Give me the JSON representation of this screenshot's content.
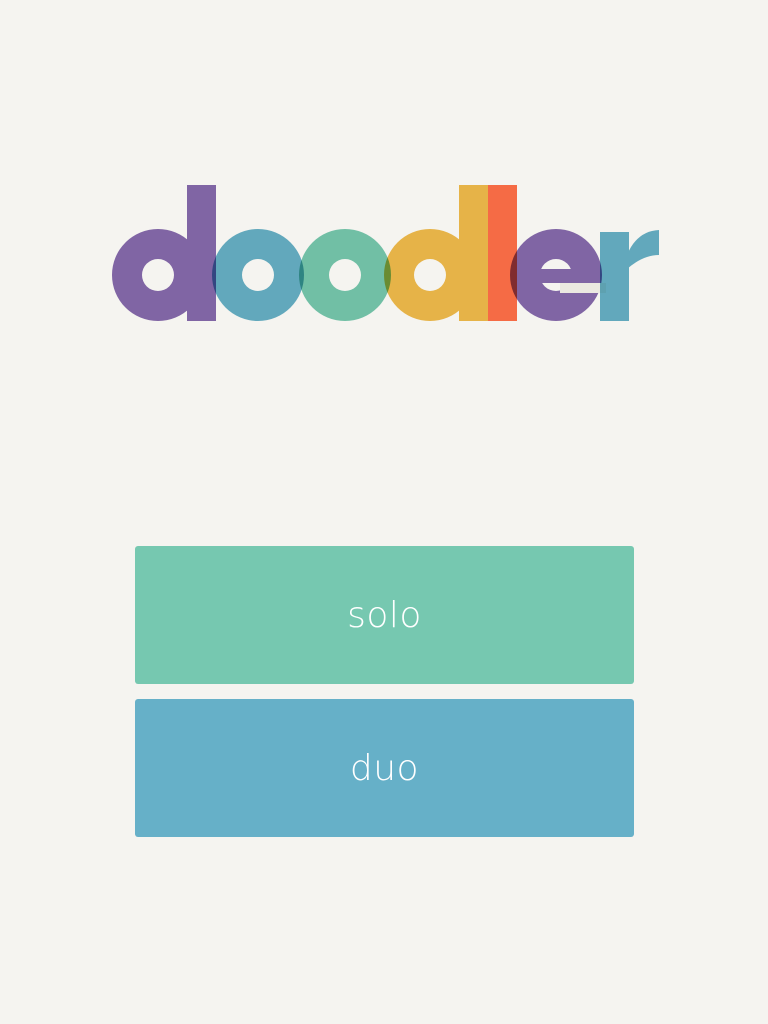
{
  "logo": {
    "text": "doodler",
    "letters": [
      {
        "char": "d",
        "color": "#8569ae"
      },
      {
        "char": "o",
        "color": "#66b0c8"
      },
      {
        "char": "o",
        "color": "#76c8b0"
      },
      {
        "char": "d",
        "color": "#f0bb4c"
      },
      {
        "char": "l",
        "color": "#ff7049"
      },
      {
        "char": "e",
        "color": "#8569ae"
      },
      {
        "char": "r",
        "color": "#66b0c8"
      }
    ]
  },
  "menu": {
    "solo": {
      "label": "solo",
      "color": "#76c8b0"
    },
    "duo": {
      "label": "duo",
      "color": "#66b0c8"
    }
  },
  "colors": {
    "background": "#f5f4f0"
  }
}
